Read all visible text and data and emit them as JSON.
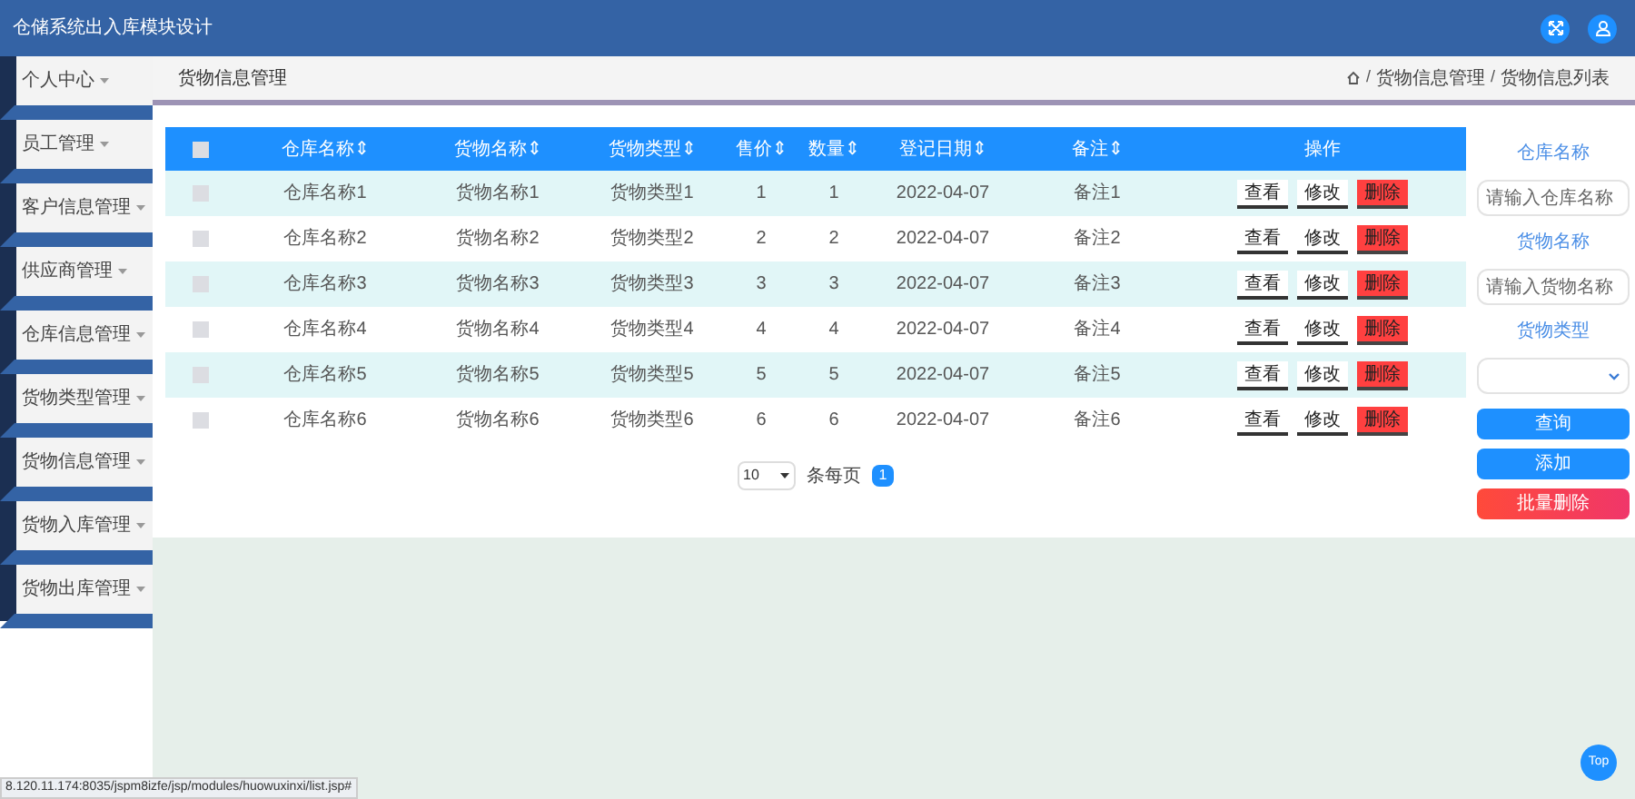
{
  "header": {
    "title": "仓储系统出入库模块设计"
  },
  "sidebar": {
    "items": [
      {
        "label": "个人中心"
      },
      {
        "label": "员工管理"
      },
      {
        "label": "客户信息管理"
      },
      {
        "label": "供应商管理"
      },
      {
        "label": "仓库信息管理"
      },
      {
        "label": "货物类型管理"
      },
      {
        "label": "货物信息管理"
      },
      {
        "label": "货物入库管理"
      },
      {
        "label": "货物出库管理"
      }
    ]
  },
  "page_title": "货物信息管理",
  "breadcrumb": [
    {
      "separator": "/",
      "label": "货物信息管理"
    },
    {
      "separator": "/",
      "label": "货物信息列表"
    }
  ],
  "table": {
    "columns": [
      "仓库名称⇕",
      "货物名称⇕",
      "货物类型⇕",
      "售价⇕",
      "数量⇕",
      "登记日期⇕",
      "备注⇕",
      "操作"
    ],
    "header_checked": false,
    "rows": [
      {
        "checked": false,
        "cells": [
          "仓库名称1",
          "货物名称1",
          "货物类型1",
          "1",
          "1",
          "2022-04-07",
          "备注1"
        ],
        "actions": [
          {
            "label": "查看",
            "kind": "plain"
          },
          {
            "label": "修改",
            "kind": "plain"
          },
          {
            "label": "删除",
            "kind": "danger"
          }
        ]
      },
      {
        "checked": false,
        "cells": [
          "仓库名称2",
          "货物名称2",
          "货物类型2",
          "2",
          "2",
          "2022-04-07",
          "备注2"
        ],
        "actions": [
          {
            "label": "查看",
            "kind": "plain"
          },
          {
            "label": "修改",
            "kind": "plain"
          },
          {
            "label": "删除",
            "kind": "danger"
          }
        ]
      },
      {
        "checked": false,
        "cells": [
          "仓库名称3",
          "货物名称3",
          "货物类型3",
          "3",
          "3",
          "2022-04-07",
          "备注3"
        ],
        "actions": [
          {
            "label": "查看",
            "kind": "plain"
          },
          {
            "label": "修改",
            "kind": "plain"
          },
          {
            "label": "删除",
            "kind": "danger"
          }
        ]
      },
      {
        "checked": false,
        "cells": [
          "仓库名称4",
          "货物名称4",
          "货物类型4",
          "4",
          "4",
          "2022-04-07",
          "备注4"
        ],
        "actions": [
          {
            "label": "查看",
            "kind": "plain"
          },
          {
            "label": "修改",
            "kind": "plain"
          },
          {
            "label": "删除",
            "kind": "danger"
          }
        ]
      },
      {
        "checked": false,
        "cells": [
          "仓库名称5",
          "货物名称5",
          "货物类型5",
          "5",
          "5",
          "2022-04-07",
          "备注5"
        ],
        "actions": [
          {
            "label": "查看",
            "kind": "plain"
          },
          {
            "label": "修改",
            "kind": "plain"
          },
          {
            "label": "删除",
            "kind": "danger"
          }
        ]
      },
      {
        "checked": false,
        "cells": [
          "仓库名称6",
          "货物名称6",
          "货物类型6",
          "6",
          "6",
          "2022-04-07",
          "备注6"
        ],
        "actions": [
          {
            "label": "查看",
            "kind": "plain"
          },
          {
            "label": "修改",
            "kind": "plain"
          },
          {
            "label": "删除",
            "kind": "danger"
          }
        ]
      }
    ]
  },
  "pagination": {
    "page_size": "10",
    "per_page_label": "条每页",
    "pages": [
      {
        "label": "1",
        "selected": true
      }
    ]
  },
  "search_panel": [
    {
      "kind": "label",
      "text": "仓库名称"
    },
    {
      "kind": "input",
      "placeholder": "请输入仓库名称"
    },
    {
      "kind": "label",
      "text": "货物名称"
    },
    {
      "kind": "input",
      "placeholder": "请输入货物名称"
    },
    {
      "kind": "label",
      "text": "货物类型"
    },
    {
      "kind": "select"
    },
    {
      "kind": "primary_button",
      "text": "查询"
    },
    {
      "kind": "primary_button",
      "text": "添加"
    },
    {
      "kind": "danger_button",
      "text": "批量删除"
    }
  ],
  "top_button": "Top",
  "status_url": "8.120.11.174:8035/jspm8izfe/jsp/modules/huowuxinxi/list.jsp#"
}
